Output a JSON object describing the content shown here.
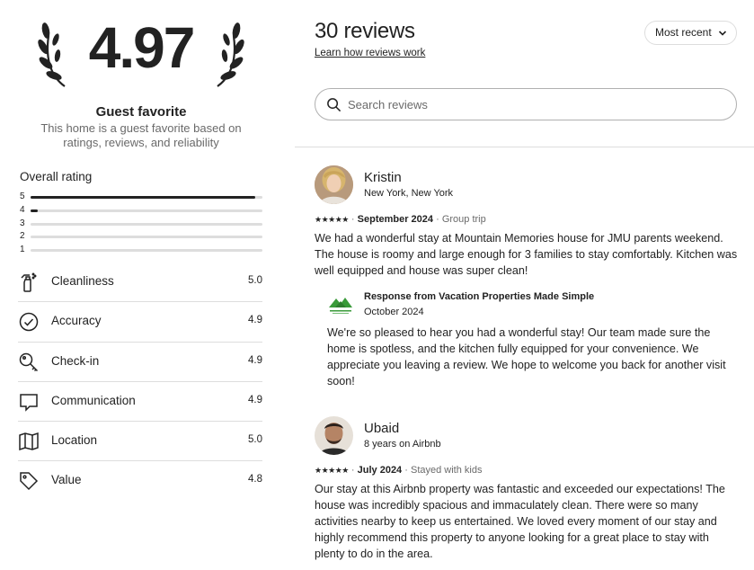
{
  "summary": {
    "score": "4.97",
    "badge_title": "Guest favorite",
    "badge_subtitle": "This home is a guest favorite based on ratings, reviews, and reliability"
  },
  "overall": {
    "label": "Overall rating",
    "distribution": [
      {
        "stars": "5",
        "fraction": 0.97
      },
      {
        "stars": "4",
        "fraction": 0.03
      },
      {
        "stars": "3",
        "fraction": 0
      },
      {
        "stars": "2",
        "fraction": 0
      },
      {
        "stars": "1",
        "fraction": 0
      }
    ]
  },
  "categories": [
    {
      "label": "Cleanliness",
      "value": "5.0",
      "icon": "spray-bottle-icon"
    },
    {
      "label": "Accuracy",
      "value": "4.9",
      "icon": "check-circle-icon"
    },
    {
      "label": "Check-in",
      "value": "4.9",
      "icon": "key-icon"
    },
    {
      "label": "Communication",
      "value": "4.9",
      "icon": "chat-bubble-icon"
    },
    {
      "label": "Location",
      "value": "5.0",
      "icon": "map-icon"
    },
    {
      "label": "Value",
      "value": "4.8",
      "icon": "tag-icon"
    }
  ],
  "reviews_header": {
    "count": "30 reviews",
    "learn_link": "Learn how reviews work",
    "sort_label": "Most recent",
    "search_placeholder": "Search reviews"
  },
  "reviews": [
    {
      "name": "Kristin",
      "location": "New York, New York",
      "stars": "★★★★★",
      "rating": 5,
      "sep": "·",
      "date": "September 2024",
      "trip": "Group trip",
      "text": "We had a wonderful stay at Mountain Memories house for JMU parents weekend. The house is roomy and large enough for 3 families to stay comfortably. Kitchen was well equipped and house was super clean!",
      "response": {
        "title": "Response from Vacation Properties Made Simple",
        "date": "October 2024",
        "text": "We're so pleased to hear you had a wonderful stay! Our team made sure the home is spotless, and the kitchen fully equipped for your convenience. We appreciate you leaving a review. We hope to welcome you back for another visit soon!"
      }
    },
    {
      "name": "Ubaid",
      "location": "8 years on Airbnb",
      "stars": "★★★★★",
      "rating": 5,
      "sep": "·",
      "date": "July 2024",
      "trip": "Stayed with kids",
      "text": "Our stay at this Airbnb property was fantastic and exceeded our expectations! The house was incredibly spacious and immaculately clean. There were so many activities nearby to keep us entertained. We loved every moment of our stay and highly recommend this property to anyone looking for a great place to stay with plenty to do in the area."
    }
  ],
  "colors": {
    "text": "#222222",
    "muted": "#6a6a6a",
    "divider": "#dddddd",
    "host_logo_green": "#3a9a3a"
  }
}
